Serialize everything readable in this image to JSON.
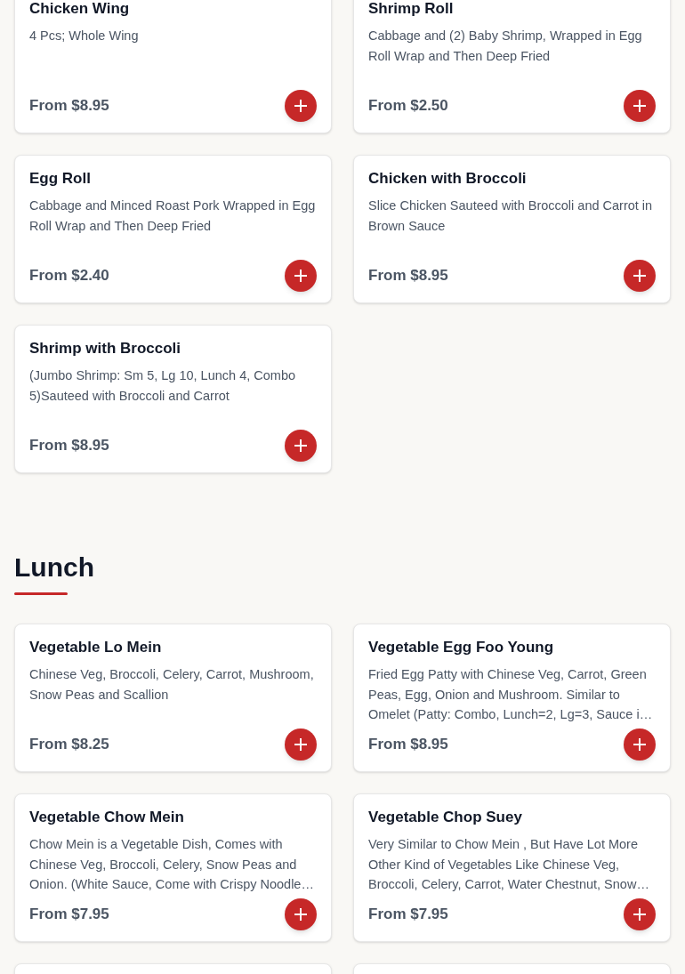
{
  "sections": [
    {
      "items": [
        {
          "kind": "item",
          "name": "Chicken Wing",
          "description": "4 Pcs; Whole Wing",
          "price": "From $8.95"
        },
        {
          "kind": "item",
          "name": "Shrimp Roll",
          "description": "Cabbage and (2) Baby Shrimp, Wrapped in Egg Roll Wrap and Then Deep Fried",
          "price": "From $2.50"
        },
        {
          "kind": "item",
          "name": "Egg Roll",
          "description": "Cabbage and Minced Roast Pork Wrapped in Egg Roll Wrap and Then Deep Fried",
          "price": "From $2.40"
        },
        {
          "kind": "item",
          "name": "Chicken with Broccoli",
          "description": "Slice Chicken Sauteed with Broccoli and Carrot in Brown Sauce",
          "price": "From $8.95"
        },
        {
          "kind": "item",
          "name": "Shrimp with Broccoli",
          "description": "(Jumbo Shrimp: Sm 5, Lg 10, Lunch 4, Combo 5)Sauteed with Broccoli and Carrot",
          "price": "From $8.95"
        }
      ]
    },
    {
      "title": "Lunch",
      "items": [
        {
          "kind": "item",
          "name": "Vegetable Lo Mein",
          "description": "Chinese Veg, Broccoli, Celery, Carrot, Mushroom, Snow Peas and Scallion",
          "price": "From $8.25"
        },
        {
          "kind": "item",
          "name": "Vegetable Egg Foo Young",
          "description": "Fried Egg Patty with Chinese Veg, Carrot, Green Peas, Egg, Onion and Mushroom. Similar to Omelet (Patty: Combo, Lunch=2, Lg=3, Sauce i…",
          "price": "From $8.95"
        },
        {
          "kind": "item",
          "name": "Vegetable Chow Mein",
          "description": "Chow Mein is a Vegetable Dish, Comes with Chinese Veg, Broccoli, Celery, Snow Peas and Onion. (White Sauce, Come with Crispy Noodle…",
          "price": "From $7.95"
        },
        {
          "kind": "item",
          "name": "Vegetable Chop Suey",
          "description": "Very Similar to Chow Mein , But Have Lot More Other Kind of Vegetables Like Chinese Veg, Broccoli, Celery, Carrot, Water Chestnut, Snow…",
          "price": "From $7.95"
        },
        {
          "kind": "partial"
        },
        {
          "kind": "partial"
        }
      ]
    }
  ]
}
